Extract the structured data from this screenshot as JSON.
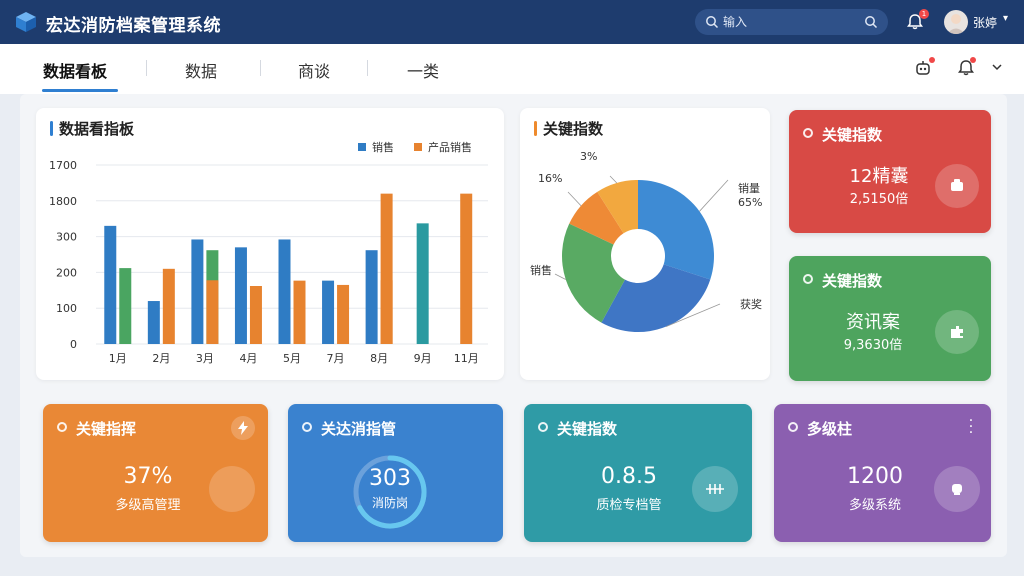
{
  "header": {
    "title": "宏达消防档案管理系统",
    "search_placeholder": "输入",
    "notification_count": "1",
    "user_name": "张婷"
  },
  "tabs": [
    {
      "label": "数据看板",
      "active": true
    },
    {
      "label": "数据",
      "active": false
    },
    {
      "label": "商谈",
      "active": false
    },
    {
      "label": "一类",
      "active": false
    }
  ],
  "bar_panel": {
    "title": "数据看指板"
  },
  "donut_panel": {
    "title": "关键指数"
  },
  "kpis": {
    "red": {
      "title": "关键指数",
      "value": "12精囊",
      "sub": "2,5150倍",
      "color": "#d84a45"
    },
    "green": {
      "title": "关键指数",
      "value": "资讯案",
      "sub": "9,3630倍",
      "color": "#4ea45e"
    },
    "orange": {
      "title": "关键指挥",
      "value": "37%",
      "sub": "多级高管理",
      "color": "#e98836"
    },
    "blue": {
      "title": "关达消指管",
      "value": "303",
      "sub": "消防岗",
      "color": "#3a82cf"
    },
    "teal": {
      "title": "关键指数",
      "value": "0.8.5",
      "sub": "质检专档管",
      "color": "#2f9ba6"
    },
    "purple": {
      "title": "多级柱",
      "value": "1200",
      "sub": "多级系统",
      "color": "#8b5fb0"
    }
  },
  "chart_data": [
    {
      "type": "bar",
      "title": "数据看指板",
      "categories": [
        "1月",
        "2月",
        "3月",
        "4月",
        "5月",
        "7月",
        "8月",
        "9月",
        "11月"
      ],
      "y_ticks": [
        "1700",
        "1800",
        "300",
        "200",
        "100",
        "0"
      ],
      "legend": [
        "销售",
        "产品销售"
      ],
      "legend_position": "top-right",
      "grid": true,
      "ylim": [
        0,
        500
      ],
      "bars": [
        {
          "category": "1月",
          "value": 330,
          "color": "#2f7cc4"
        },
        {
          "category": "1月",
          "value": 212,
          "color": "#4aa561"
        },
        {
          "category": "2月",
          "value": 120,
          "color": "#2f7cc4"
        },
        {
          "category": "2月",
          "value": 210,
          "color": "#e7832f"
        },
        {
          "category": "3月",
          "value": 292,
          "color": "#2f7cc4"
        },
        {
          "category": "3月",
          "value": 262,
          "color": "#4aa561",
          "cap_value": 178,
          "cap_color": "#e7832f"
        },
        {
          "category": "4月",
          "value": 270,
          "color": "#2f7cc4"
        },
        {
          "category": "4月",
          "value": 162,
          "color": "#e7832f"
        },
        {
          "category": "5月",
          "value": 292,
          "color": "#2f7cc4"
        },
        {
          "category": "5月",
          "value": 177,
          "color": "#e7832f"
        },
        {
          "category": "7月",
          "value": 177,
          "color": "#2f7cc4"
        },
        {
          "category": "7月",
          "value": 165,
          "color": "#e7832f"
        },
        {
          "category": "8月",
          "value": 262,
          "color": "#2f7cc4"
        },
        {
          "category": "8月",
          "value": 420,
          "color": "#e7832f",
          "cap_value": 178
        },
        {
          "category": "9月",
          "value": 337,
          "color": "#2a9aa0"
        },
        {
          "category": "11月",
          "value": 420,
          "color": "#e7832f"
        }
      ]
    },
    {
      "type": "pie",
      "title": "关键指数",
      "slices": [
        {
          "label": "销量",
          "pct_label": "65%",
          "value": 30,
          "color": "#3e8bd4"
        },
        {
          "label": "获奖",
          "pct_label": "",
          "value": 28,
          "color": "#3f76c5"
        },
        {
          "label": "销售",
          "pct_label": "",
          "value": 24,
          "color": "#59aa63"
        },
        {
          "label": "",
          "pct_label": "16%",
          "value": 9,
          "color": "#ee8a36"
        },
        {
          "label": "",
          "pct_label": "3%",
          "value": 9,
          "color": "#f2a83f"
        }
      ]
    }
  ],
  "colors": {
    "header_bg": "#1e3c6e",
    "accent": "#2f7fd1",
    "bell_badge": "#f04848"
  },
  "icons": [
    "logo-cube-icon",
    "search-icon",
    "bell-icon",
    "chevron-down-icon",
    "robot-icon",
    "lightning-icon",
    "more-icon"
  ]
}
